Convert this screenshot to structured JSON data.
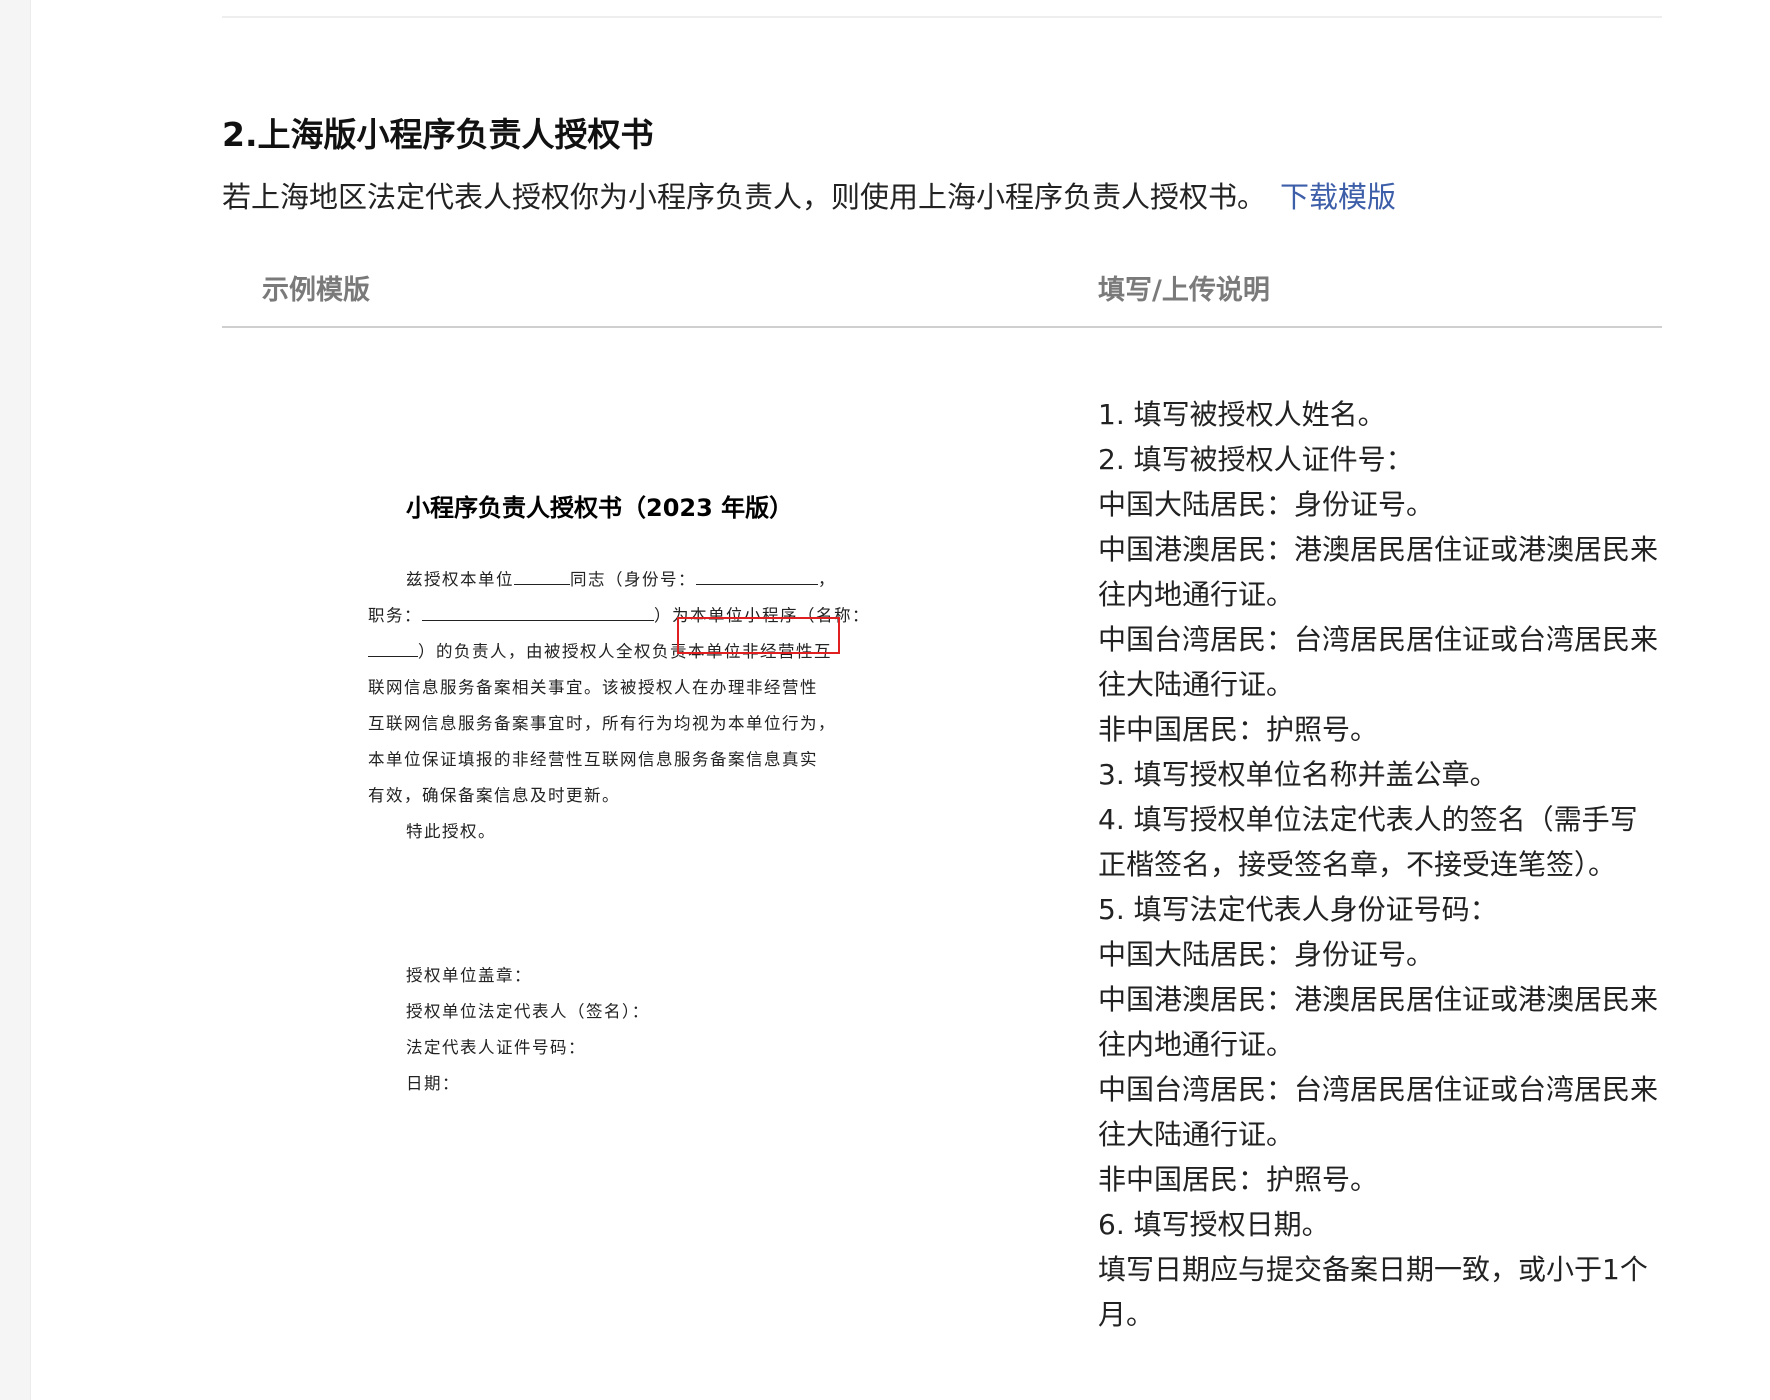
{
  "section": {
    "title": "2.上海版小程序负责人授权书",
    "intro": "若上海地区法定代表人授权你为小程序负责人，则使用上海小程序负责人授权书。",
    "download_link": "下载模版"
  },
  "table": {
    "col_example": "示例模版",
    "col_instructions": "填写/上传说明"
  },
  "document": {
    "title": "小程序负责人授权书（2023 年版）",
    "p1_a": "兹授权本单位",
    "p1_b": "同志（身份号：",
    "p1_c": "，",
    "p2_a": "职务：",
    "p2_b": "）为本单位小程序（名称：",
    "p3_a": "）的负责人，由被授权人全权负责本单位非经营性互",
    "p4": "联网信息服务备案相关事宜。该被授权人在办理非经营性",
    "p5": "互联网信息服务备案事宜时，所有行为均视为本单位行为，",
    "p6": "本单位保证填报的非经营性互联网信息服务备案信息真实",
    "p7": "有效，确保备案信息及时更新。",
    "p8": "特此授权。",
    "sig1": "授权单位盖章：",
    "sig2": "授权单位法定代表人（签名）：",
    "sig3": "法定代表人证件号码：",
    "sig4": "日期："
  },
  "instructions": [
    "1. 填写被授权人姓名。",
    "2. 填写被授权人证件号：",
    "中国大陆居民：身份证号。",
    "中国港澳居民：港澳居民居住证或港澳居民来往内地通行证。",
    "中国台湾居民：台湾居民居住证或台湾居民来往大陆通行证。",
    "非中国居民：护照号。",
    "3. 填写授权单位名称并盖公章。",
    "4. 填写授权单位法定代表人的签名（需手写正楷签名，接受签名章，不接受连笔签）。",
    "5. 填写法定代表人身份证号码：",
    "中国大陆居民：身份证号。",
    "中国港澳居民：港澳居民居住证或港澳居民来往内地通行证。",
    "中国台湾居民：台湾居民居住证或台湾居民来往大陆通行证。",
    "非中国居民：护照号。",
    "6. 填写授权日期。",
    "填写日期应与提交备案日期一致，或小于1个月。"
  ]
}
